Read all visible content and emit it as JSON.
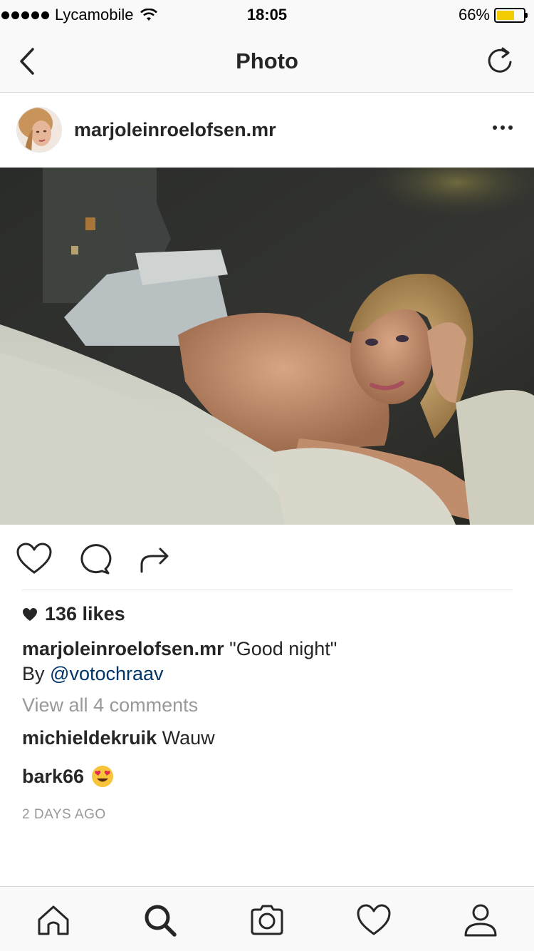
{
  "status_bar": {
    "carrier": "Lycamobile",
    "time": "18:05",
    "battery_percent": "66%",
    "battery_level": 0.66
  },
  "nav": {
    "title": "Photo",
    "back_icon": "chevron-left-icon",
    "refresh_icon": "refresh-icon"
  },
  "post": {
    "username": "marjoleinroelofsen.mr",
    "likes": "136 likes",
    "caption_user": "marjoleinroelofsen.mr",
    "caption_text": "\"Good night\"",
    "by_prefix": "By",
    "by_mention": "@votochraav",
    "view_all": "View all 4 comments",
    "comments": [
      {
        "user": "michieldekruik",
        "text": "Wauw"
      },
      {
        "user": "bark66",
        "text": "😍"
      }
    ],
    "time_ago": "2 DAYS AGO"
  },
  "colors": {
    "link": "#003569",
    "muted": "#999999",
    "text": "#262626",
    "battery": "#f2cc00"
  },
  "tab_bar": {
    "icons": [
      "home-icon",
      "search-icon",
      "camera-icon",
      "heart-icon",
      "profile-icon"
    ],
    "active": "search-icon"
  }
}
